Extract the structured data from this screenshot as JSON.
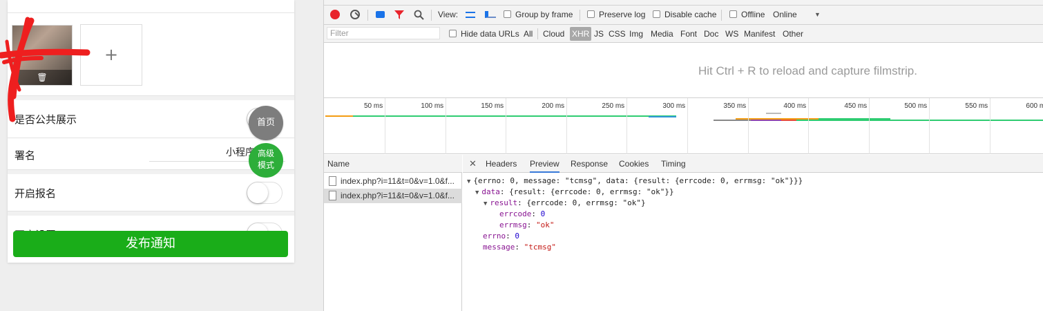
{
  "mobile": {
    "public_label": "是否公共展示",
    "signature_label": "署名",
    "signature_value": "小程序开发",
    "registration_label": "开启报名",
    "hidden_row_label": "开启设置",
    "add_symbol": "+",
    "delete_symbol": "🗑",
    "float_home": "首页",
    "float_advanced_line1": "高级",
    "float_advanced_line2": "模式",
    "publish_button": "发布通知",
    "accent_color": "#1aad19"
  },
  "devtools": {
    "toolbar": {
      "view_label": "View:",
      "group_by_frame": "Group by frame",
      "preserve_log": "Preserve log",
      "disable_cache": "Disable cache",
      "offline": "Offline",
      "throttle": "Online"
    },
    "filter": {
      "placeholder": "Filter",
      "hide_data_urls": "Hide data URLs",
      "types": [
        "All",
        "Cloud",
        "XHR",
        "JS",
        "CSS",
        "Img",
        "Media",
        "Font",
        "Doc",
        "WS",
        "Manifest",
        "Other"
      ],
      "active_type": "XHR"
    },
    "filmstrip_hint": "Hit Ctrl + R to reload and capture filmstrip.",
    "timeline_ticks": [
      "50 ms",
      "100 ms",
      "150 ms",
      "200 ms",
      "250 ms",
      "300 ms",
      "350 ms",
      "400 ms",
      "450 ms",
      "500 ms",
      "550 ms",
      "600 ms"
    ],
    "name_header": "Name",
    "requests": [
      {
        "name": "index.php?i=11&t=0&v=1.0&f...",
        "selected": false
      },
      {
        "name": "index.php?i=11&t=0&v=1.0&f...",
        "selected": true
      }
    ],
    "detail_tabs": [
      "Headers",
      "Preview",
      "Response",
      "Cookies",
      "Timing"
    ],
    "active_tab": "Preview",
    "preview": {
      "summary": "{errno: 0, message: \"tcmsg\", data: {result: {errcode: 0, errmsg: \"ok\"}}}",
      "data_key": "data",
      "data_summary": "{result: {errcode: 0, errmsg: \"ok\"}}",
      "result_key": "result",
      "result_summary": "{errcode: 0, errmsg: \"ok\"}",
      "errcode_key": "errcode",
      "errcode_val": "0",
      "errmsg_key": "errmsg",
      "errmsg_val": "\"ok\"",
      "errno_key": "errno",
      "errno_val": "0",
      "message_key": "message",
      "message_val": "\"tcmsg\""
    }
  }
}
